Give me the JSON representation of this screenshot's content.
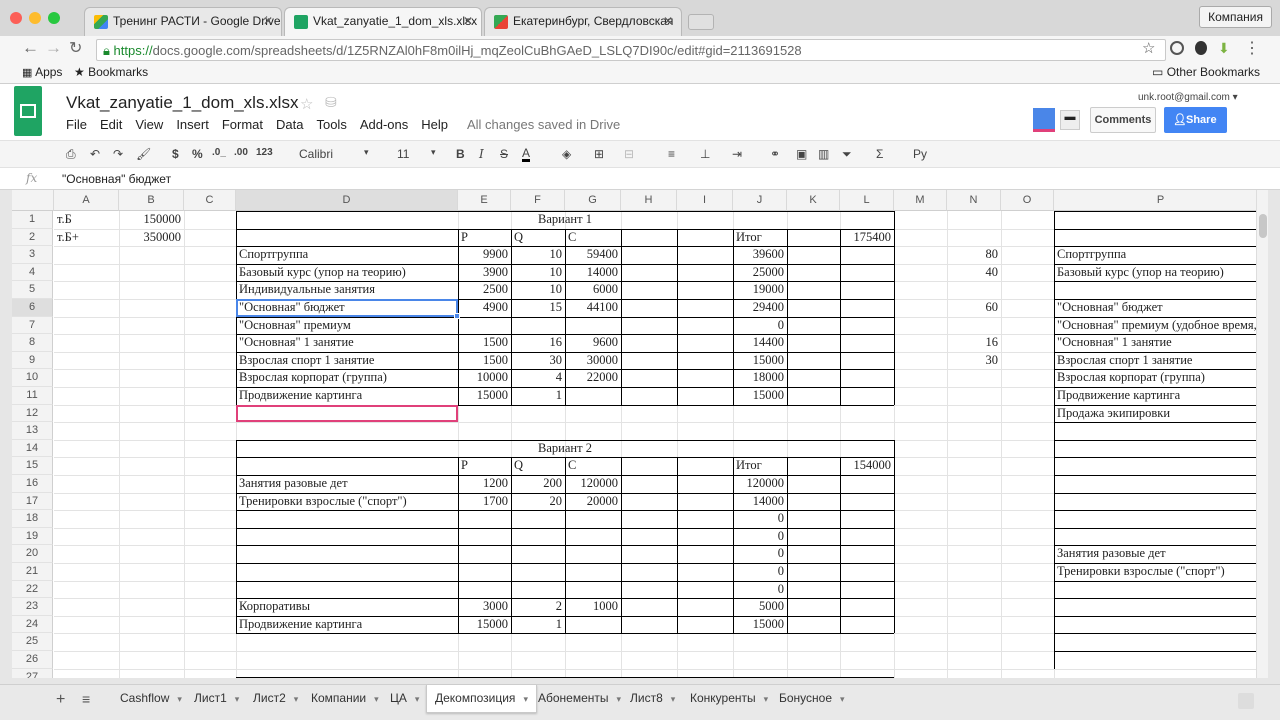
{
  "browser": {
    "tabs": [
      {
        "title": "Тренинг РАСТИ - Google Drive",
        "icon": "drive-icon"
      },
      {
        "title": "Vkat_zanyatie_1_dom_xls.xlsx",
        "icon": "sheets-icon"
      },
      {
        "title": "Екатеринбург, Свердловская",
        "icon": "maps-icon"
      }
    ],
    "profile": "Компания",
    "url_scheme": "https://",
    "url_rest": "docs.google.com/spreadsheets/d/1Z5RNZAl0hF8m0ilHj_mqZeolCuBhGAeD_LSLQ7DI90c/edit#gid=2113691528",
    "bookmarks": {
      "apps": "Apps",
      "bookmarks": "Bookmarks",
      "other": "Other Bookmarks"
    }
  },
  "sheets": {
    "title": "Vkat_zanyatie_1_dom_xls.xlsx",
    "menu": [
      "File",
      "Edit",
      "View",
      "Insert",
      "Format",
      "Data",
      "Tools",
      "Add-ons",
      "Help"
    ],
    "saved": "All changes saved in Drive",
    "account": "unk.root@gmail.com",
    "comments": "Comments",
    "share": "Share",
    "toolbar": {
      "currency": "$",
      "percent": "%",
      "dec0": ".0_",
      "dec00": ".00",
      "fmt123": "123",
      "font": "Calibri",
      "size": "11",
      "lang": "Ру"
    },
    "formula": "\"Основная\"  бюджет",
    "columns": [
      "A",
      "B",
      "C",
      "D",
      "E",
      "F",
      "G",
      "H",
      "I",
      "J",
      "K",
      "L",
      "M",
      "N",
      "O",
      "P"
    ],
    "rows": [
      "1",
      "2",
      "3",
      "4",
      "5",
      "6",
      "7",
      "8",
      "9",
      "10",
      "11",
      "12",
      "13",
      "14",
      "15",
      "16",
      "17",
      "18",
      "19",
      "20",
      "21",
      "22",
      "23",
      "24",
      "25",
      "26",
      "27"
    ],
    "cells": {
      "A1": "т.Б",
      "B1": "150000",
      "D1": "Вариант 1",
      "A2": "т.Б+",
      "B2": "350000",
      "E2": "P",
      "F2": "Q",
      "G2": "C",
      "J2": "Итог",
      "L2": "175400",
      "D3": "Спортгруппа",
      "E3": "9900",
      "F3": "10",
      "G3": "59400",
      "J3": "39600",
      "N3": "80",
      "P3": "Спортгруппа",
      "D4": "Базовый курс (упор на теорию)",
      "E4": "3900",
      "F4": "10",
      "G4": "14000",
      "J4": "25000",
      "N4": "40",
      "P4": "Базовый курс (упор на теорию)",
      "D5": "Индивидуальные занятия",
      "E5": "2500",
      "F5": "10",
      "G5": "6000",
      "J5": "19000",
      "D6": "\"Основная\" бюджет",
      "E6": "4900",
      "F6": "15",
      "G6": "44100",
      "J6": "29400",
      "N6": "60",
      "P6": "\"Основная\" бюджет",
      "D7": "\"Основная\" премиум",
      "J7": "0",
      "P7": "\"Основная\" премиум (удобное время,",
      "D8": "\"Основная\" 1 занятие",
      "E8": "1500",
      "F8": "16",
      "G8": "9600",
      "J8": "14400",
      "N8": "16",
      "P8": "\"Основная\" 1 занятие",
      "D9": "Взрослая спорт 1 занятие",
      "E9": "1500",
      "F9": "30",
      "G9": "30000",
      "J9": "15000",
      "N9": "30",
      "P9": "Взрослая спорт 1 занятие",
      "D10": "Взрослая корпорат (группа)",
      "E10": "10000",
      "F10": "4",
      "G10": "22000",
      "J10": "18000",
      "P10": "Взрослая корпорат (группа)",
      "D11": "Продвижение картинга",
      "E11": "15000",
      "F11": "1",
      "J11": "15000",
      "P11": "Продвижение картинга",
      "P12": "Продажа экипировки",
      "D14": "Вариант 2",
      "E15": "P",
      "F15": "Q",
      "G15": "C",
      "J15": "Итог",
      "L15": "154000",
      "D16": "Занятия разовые дет",
      "E16": "1200",
      "F16": "200",
      "G16": "120000",
      "J16": "120000",
      "D17": "Тренировки взрослые (\"спорт\")",
      "E17": "1700",
      "F17": "20",
      "G17": "20000",
      "J17": "14000",
      "J18": "0",
      "J19": "0",
      "J20": "0",
      "P20": "Занятия разовые дет",
      "J21": "0",
      "P21": "Тренировки взрослые (\"спорт\")",
      "J22": "0",
      "D23": "Корпоративы",
      "E23": "3000",
      "F23": "2",
      "G23": "1000",
      "J23": "5000",
      "D24": "Продвижение картинга",
      "E24": "15000",
      "F24": "1",
      "J24": "15000"
    },
    "sheet_tabs": [
      "Cashflow",
      "Лист1",
      "Лист2",
      "Компании",
      "ЦА",
      "Декомпозиция",
      "Абонементы",
      "Лист8",
      "Конкуренты",
      "Бонусное"
    ],
    "active_sheet": "Декомпозиция",
    "colors": {
      "accent": "#4285f4",
      "sheets_green": "#1fa463",
      "selection": "#4a86e8",
      "pink_border": "#e0407a"
    }
  }
}
